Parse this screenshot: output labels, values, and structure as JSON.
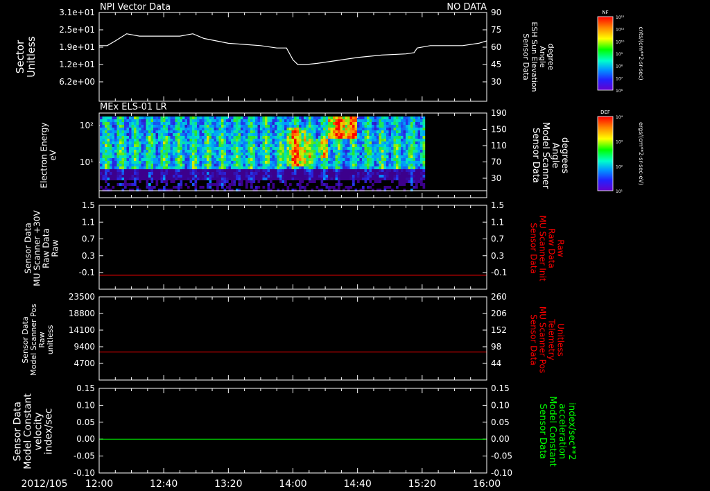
{
  "colors": {
    "background": "#000000",
    "axis": "#ffffff",
    "red": "#ff0000",
    "green": "#00ff00"
  },
  "chart_data": [
    {
      "type": "line",
      "title": "NPI Vector Data",
      "status": "NO DATA",
      "ylabel_left": [
        "Sector",
        "Unitless"
      ],
      "ylabel_right": [
        "Sensor Data",
        "ESH Sun Elevation",
        "Angle",
        "degree"
      ],
      "left_ticks": [
        "3.1e+01",
        "2.5e+01",
        "1.9e+01",
        "1.2e+01",
        "6.2e+00"
      ],
      "right_ticks": [
        "90",
        "75",
        "60",
        "45",
        "30"
      ],
      "ylim_right": [
        15,
        90
      ],
      "series": [
        {
          "x": [
            "12:00",
            "12:05",
            "12:10",
            "12:17",
            "12:25",
            "12:40",
            "12:50",
            "12:58",
            "13:05",
            "13:20",
            "13:40",
            "13:50",
            "13:56",
            "14:00",
            "14:03",
            "14:08",
            "14:15",
            "14:25",
            "14:40",
            "14:55",
            "15:10",
            "15:15",
            "15:17",
            "15:25",
            "15:35",
            "15:45",
            "15:55",
            "16:00"
          ],
          "y": [
            62,
            62,
            66,
            72,
            70,
            70,
            70,
            72,
            68,
            64,
            62,
            60,
            60,
            50,
            46,
            46,
            47,
            49,
            52,
            54,
            55,
            56,
            60,
            62,
            62,
            62,
            64,
            66
          ]
        }
      ]
    },
    {
      "type": "heatmap",
      "title": "MEx ELS-01 LR",
      "ylabel_left": [
        "Electron Energy",
        "eV"
      ],
      "ylabel_right": [
        "Sensor Data",
        "Model Scanner",
        "Angle",
        "degrees"
      ],
      "left_ticks": [
        "10²",
        "10¹"
      ],
      "right_ticks": [
        "190",
        "150",
        "110",
        "70",
        "30"
      ],
      "colorbar": {
        "label": "DEF",
        "unit": "ergs/(cm**2-sr-sec-eV)",
        "ticks": [
          "10⁴",
          "10³",
          "10²",
          "10¹"
        ]
      },
      "data_end": "15:21"
    },
    {
      "type": "line",
      "ylabel_left": [
        "Sensor Data",
        "MU Scanner +30V",
        "Raw Data",
        "Raw"
      ],
      "ylabel_right": [
        "Sensor Data",
        "MU Scanner Init",
        "Raw Data",
        "Raw"
      ],
      "left_ticks": [
        "1.5",
        "1.1",
        "0.7",
        "0.3",
        "-0.1"
      ],
      "right_ticks": [
        "1.5",
        "1.1",
        "0.7",
        "0.3",
        "-0.1"
      ],
      "ylim": [
        -0.3,
        1.5
      ],
      "series": [
        {
          "color": "red",
          "x": [
            "12:00",
            "16:00"
          ],
          "y": [
            0.0,
            0.0
          ]
        }
      ]
    },
    {
      "type": "line",
      "ylabel_left": [
        "Sensor Data",
        "Model Scanner Pos",
        "Raw",
        "unitless"
      ],
      "ylabel_right": [
        "Sensor Data",
        "MU Scanner Pos",
        "Telemetry",
        "Unitless"
      ],
      "left_ticks": [
        "23500",
        "18800",
        "14100",
        "9400",
        "4700"
      ],
      "right_ticks": [
        "260",
        "206",
        "152",
        "98",
        "44"
      ],
      "ylim": [
        0,
        23500
      ],
      "series": [
        {
          "color": "red",
          "x": [
            "12:00",
            "16:00"
          ],
          "y": [
            7900,
            7900
          ]
        }
      ]
    },
    {
      "type": "line",
      "ylabel_left": [
        "Sensor Data",
        "Model Constant",
        "velocity",
        "index/sec"
      ],
      "ylabel_right": [
        "Sensor Data",
        "Model Constant",
        "acceleration",
        "index/sec**2"
      ],
      "left_ticks": [
        "0.15",
        "0.10",
        "0.05",
        "0.00",
        "-0.05",
        "-0.10"
      ],
      "right_ticks": [
        "0.15",
        "0.10",
        "0.05",
        "0.00",
        "-0.05",
        "-0.10"
      ],
      "ylim": [
        -0.1,
        0.15
      ],
      "series": [
        {
          "color": "green",
          "x": [
            "12:00",
            "16:00"
          ],
          "y": [
            0.0,
            0.0
          ]
        }
      ]
    }
  ],
  "colorbar_top": {
    "label": "NF",
    "unit": "cnts/(cm**2-sr-sec)",
    "ticks": [
      "10¹²",
      "10¹¹",
      "10¹⁰",
      "10⁹",
      "10⁸",
      "10⁷",
      "10⁶"
    ]
  },
  "x_axis": {
    "date": "2012/105",
    "ticks": [
      "12:00",
      "12:40",
      "13:20",
      "14:00",
      "14:40",
      "15:20",
      "16:00"
    ],
    "start": "12:00",
    "end": "16:00"
  }
}
